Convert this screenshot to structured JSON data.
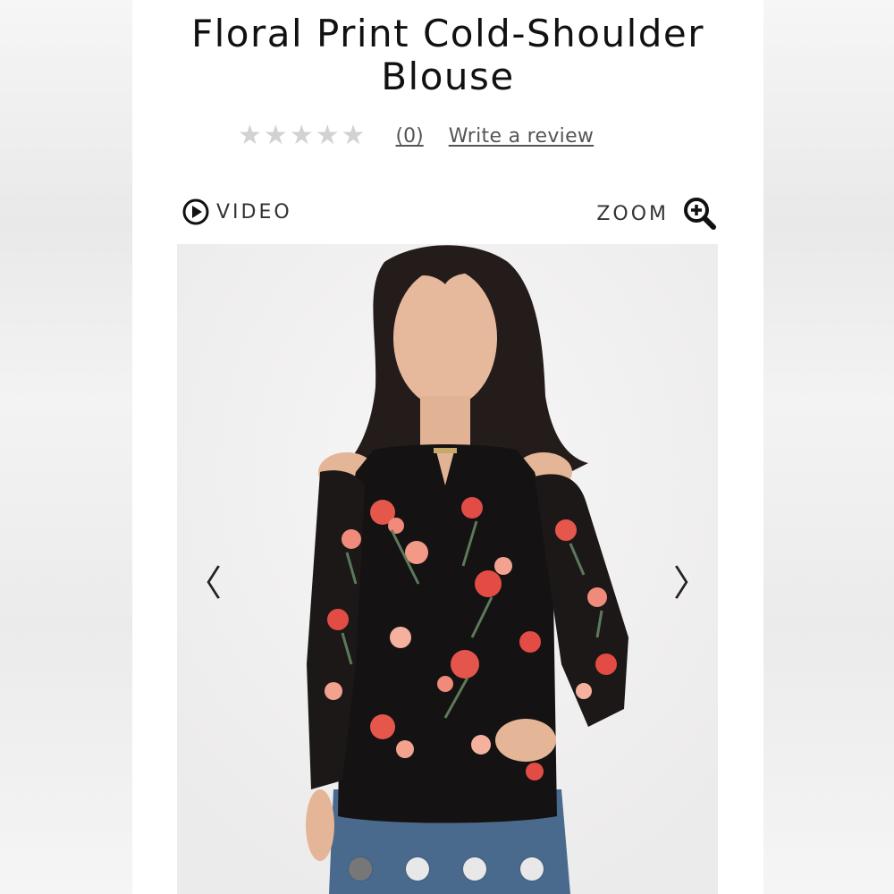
{
  "product": {
    "title_line1": "Floral Print Cold-Shoulder",
    "title_line2": "Blouse"
  },
  "rating": {
    "stars": 0,
    "max_stars": 5,
    "count_text": "(0)",
    "write_review_label": "Write a review"
  },
  "media": {
    "video_label": "VIDEO",
    "zoom_label": "ZOOM",
    "video_icon": "play-circle-icon",
    "zoom_icon": "zoom-in-icon",
    "prev_arrow": "〈",
    "next_arrow": "〉",
    "slide_count": 4,
    "active_slide": 1
  },
  "colors": {
    "text": "#111111",
    "star_empty": "#d2d2d2",
    "dot_active": "#777777",
    "dot_inactive": "#e8e8e8"
  }
}
